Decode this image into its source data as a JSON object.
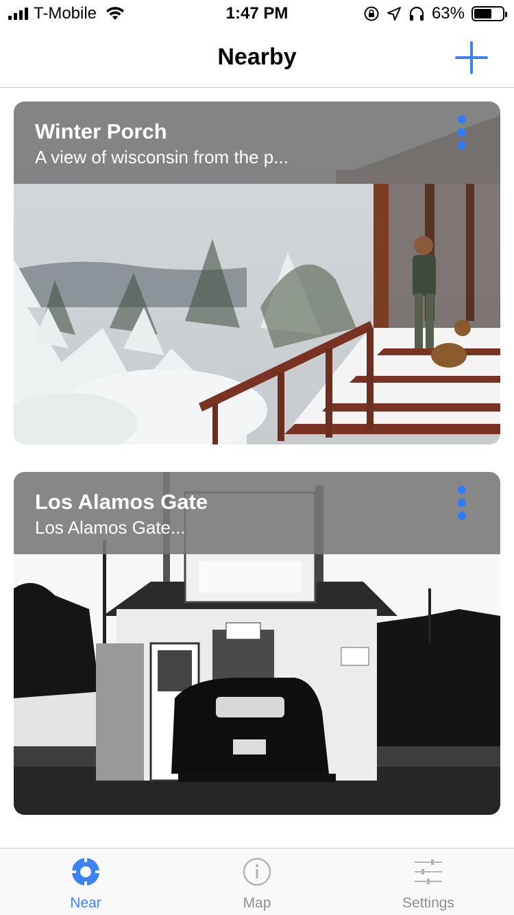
{
  "status_bar": {
    "carrier": "T-Mobile",
    "time": "1:47 PM",
    "battery": "63%",
    "battery_level": 0.63,
    "icons": [
      "signal-icon",
      "wifi-icon",
      "rotation-lock-icon",
      "location-icon",
      "headphones-icon",
      "battery-icon"
    ]
  },
  "nav": {
    "title": "Nearby",
    "add_icon": "plus-icon"
  },
  "cards": [
    {
      "title": "Winter Porch",
      "subtitle": "A view of wisconsin from the p...",
      "image": "winter-porch-photo",
      "more_icon": "more-vertical-icon"
    },
    {
      "title": "Los Alamos Gate",
      "subtitle": "Los Alamos Gate...",
      "image": "los-alamos-gate-photo",
      "more_icon": "more-vertical-icon"
    }
  ],
  "tabs": [
    {
      "label": "Near",
      "icon": "crosshair-icon",
      "active": true
    },
    {
      "label": "Map",
      "icon": "info-icon",
      "active": false
    },
    {
      "label": "Settings",
      "icon": "sliders-icon",
      "active": false
    }
  ],
  "colors": {
    "accent": "#3b82f6",
    "more_dots": "#2f7bff",
    "inactive_tab": "#8e8e93",
    "overlay": "#787878"
  }
}
